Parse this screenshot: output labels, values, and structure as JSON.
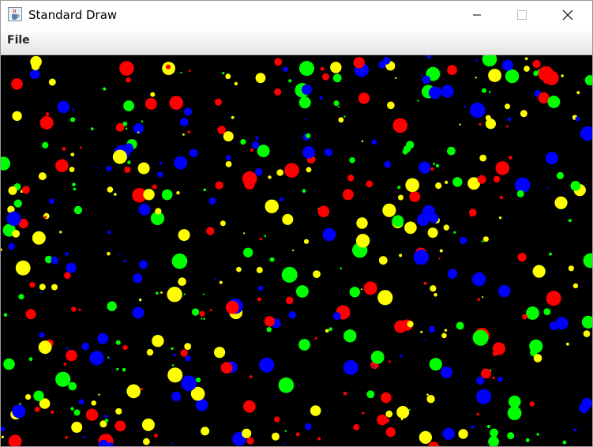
{
  "window": {
    "title": "Standard Draw",
    "app_icon": "java-coffee-cup-icon",
    "controls": [
      "minimize-icon",
      "maximize-icon",
      "close-icon"
    ]
  },
  "menubar": {
    "items": [
      {
        "label": "File"
      }
    ]
  },
  "canvas": {
    "background": "#000000",
    "palette": {
      "red": "#ff0000",
      "green": "#00ff00",
      "blue": "#0000ff",
      "yellow": "#ffff00"
    }
  }
}
